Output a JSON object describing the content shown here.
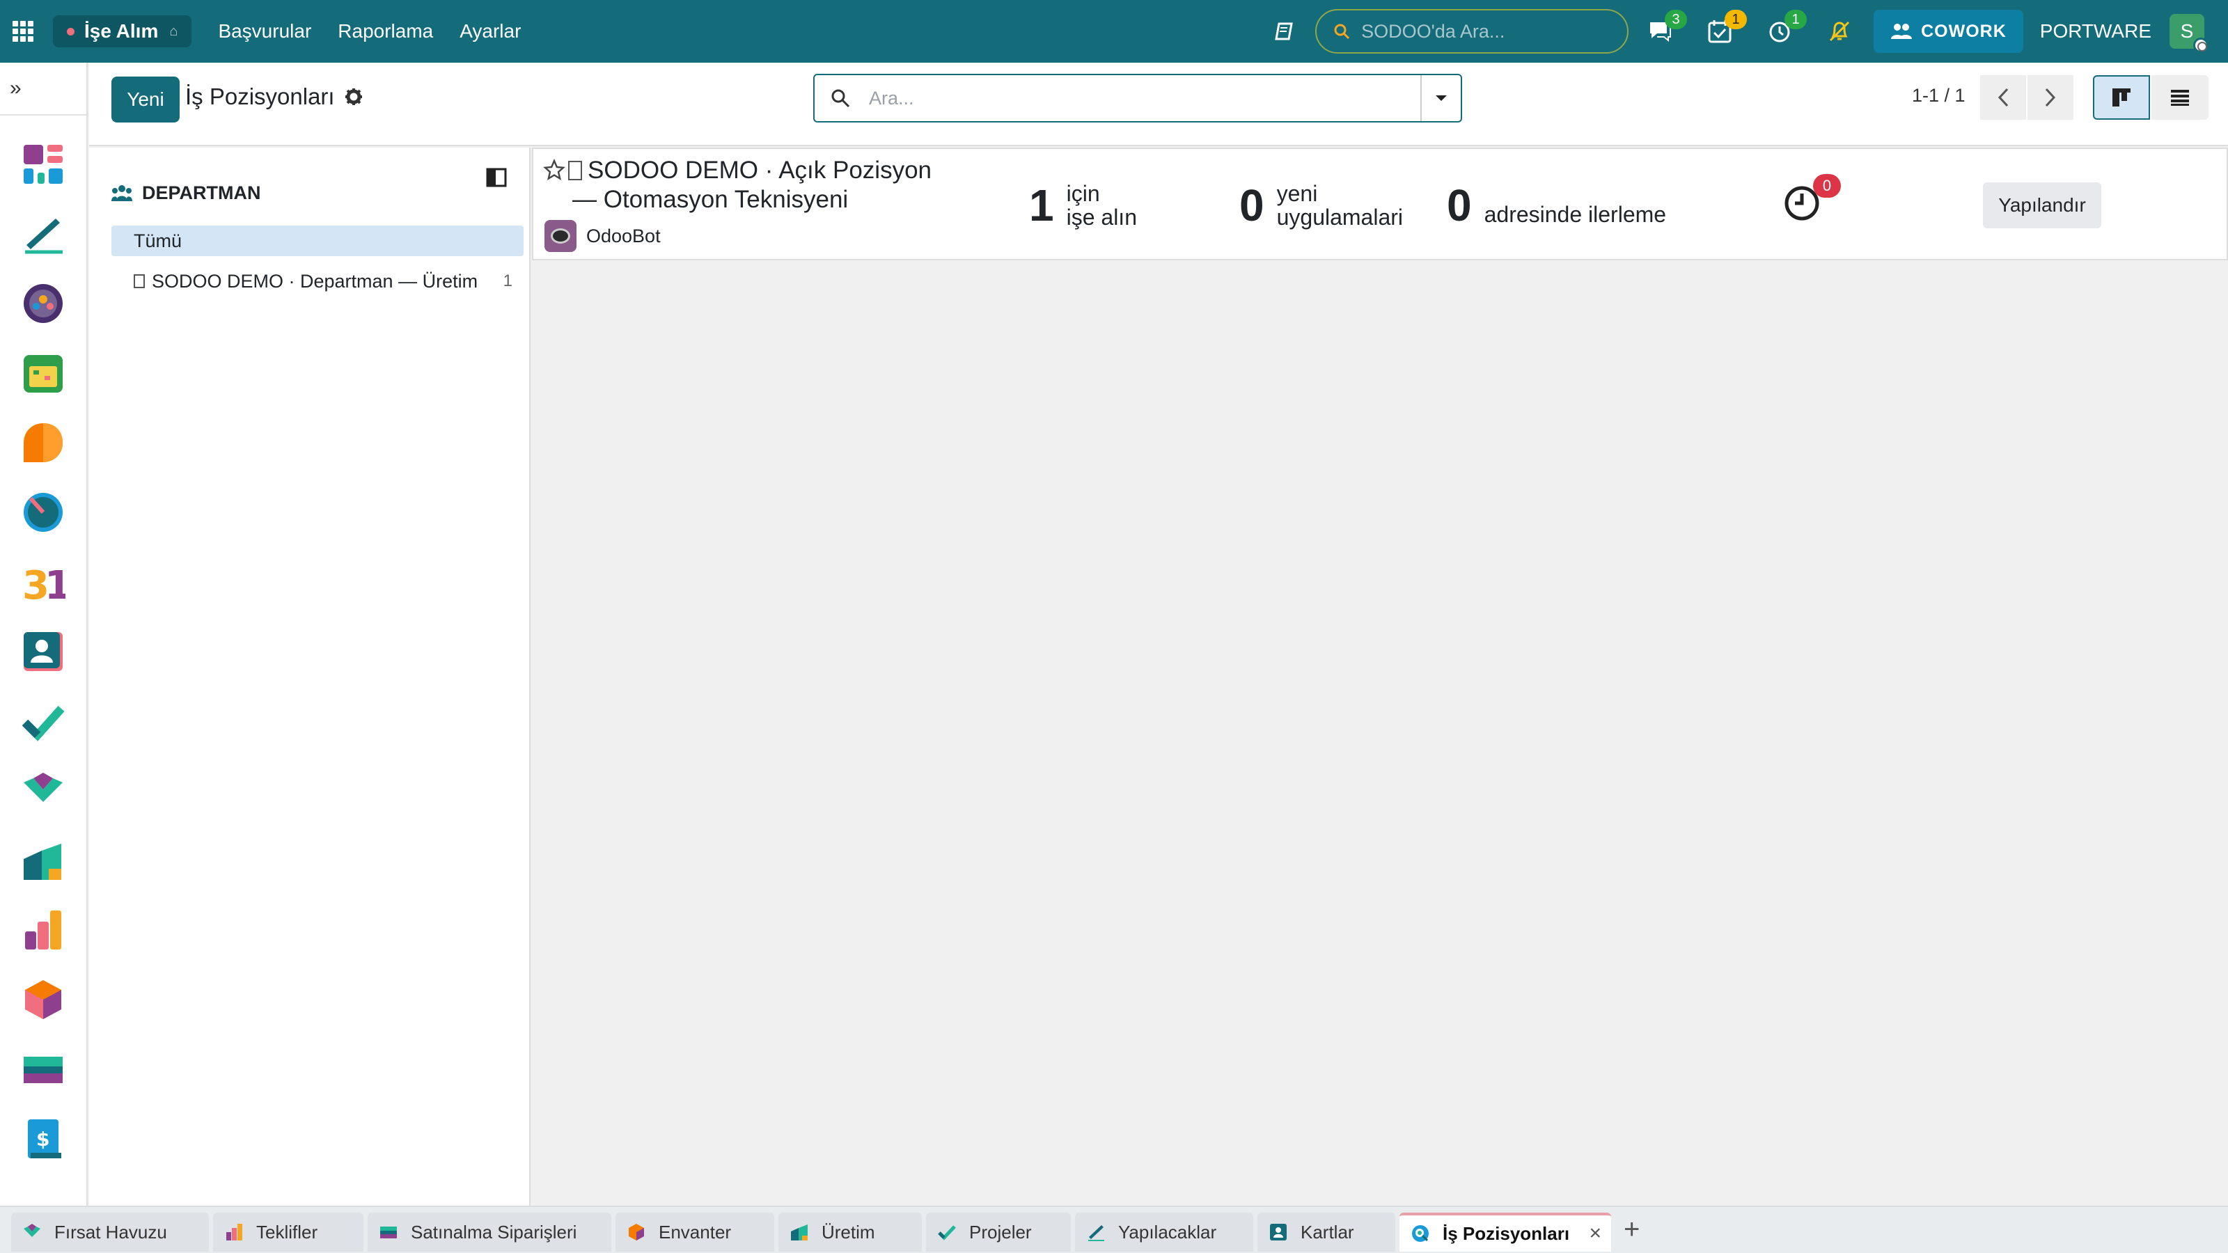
{
  "navbar": {
    "app_name": "İşe Alım",
    "menu": [
      "Başvurular",
      "Raporlama",
      "Ayarlar"
    ],
    "search_placeholder": "SODOO'da Ara...",
    "messages_count": "3",
    "activities_count": "1",
    "timer_count": "1",
    "cowork_label": "COWORK",
    "company": "PORTWARE",
    "user_initial": "S",
    "bg_color": "#146b7a"
  },
  "control_panel": {
    "new_label": "Yeni",
    "title": "İş Pozisyonları",
    "search_placeholder": "Ara...",
    "pager": "1-1 / 1"
  },
  "search_panel": {
    "header": "DEPARTMAN",
    "items": [
      {
        "label": "Tümü",
        "count": ""
      },
      {
        "label": "SODOO DEMO · Departman — Üretim",
        "count": "1"
      }
    ]
  },
  "job_card": {
    "title_line1": "SODOO DEMO · Açık Pozisyon",
    "title_line2": "— Otomasyon Teknisyeni",
    "company": "OdooBot",
    "stats": [
      {
        "num": "1",
        "label_line1": "için",
        "label_line2": "işe alın"
      },
      {
        "num": "0",
        "label_line1": "yeni",
        "label_line2": "uygulamalari"
      },
      {
        "num": "0",
        "label_line1": "adresinde ilerleme",
        "label_line2": ""
      }
    ],
    "activity_count": "0",
    "config_label": "Yapılandır"
  },
  "tabs": [
    {
      "label": "Fırsat Havuzu",
      "icon": "crm-icon"
    },
    {
      "label": "Teklifler",
      "icon": "sales-icon"
    },
    {
      "label": "Satınalma Siparişleri",
      "icon": "purchase-icon"
    },
    {
      "label": "Envanter",
      "icon": "inventory-icon"
    },
    {
      "label": "Üretim",
      "icon": "manufacturing-icon"
    },
    {
      "label": "Projeler",
      "icon": "project-icon"
    },
    {
      "label": "Yapılacaklar",
      "icon": "todo-icon"
    },
    {
      "label": "Kartlar",
      "icon": "contacts-icon"
    },
    {
      "label": "İş Pozisyonları",
      "icon": "recruitment-icon"
    }
  ]
}
